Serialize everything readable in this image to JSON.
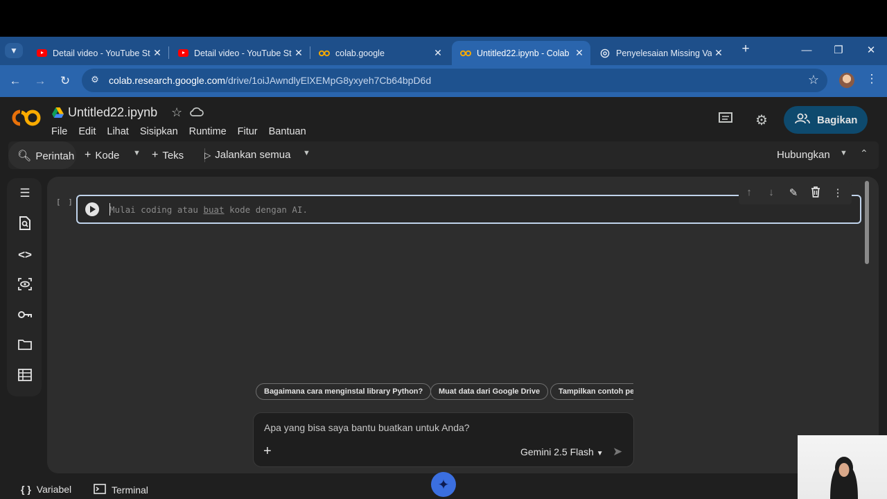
{
  "browser": {
    "tabs": [
      {
        "title": "Detail video - YouTube Studio",
        "icon": "youtube-icon",
        "active": false
      },
      {
        "title": "Detail video - YouTube Studio",
        "icon": "youtube-icon",
        "active": false
      },
      {
        "title": "colab.google",
        "icon": "colab-icon",
        "active": false
      },
      {
        "title": "Untitled22.ipynb - Colab",
        "icon": "colab-icon",
        "active": true
      },
      {
        "title": "Penyelesaian Missing Values",
        "icon": "chatgpt-icon",
        "active": false
      }
    ],
    "url_host": "colab.research.google.com",
    "url_path": "/drive/1oiJAwndlyElXEMpG8yxyeh7Cb64bpD6d"
  },
  "colab": {
    "notebook_title": "Untitled22.ipynb",
    "menu": [
      "File",
      "Edit",
      "Lihat",
      "Sisipkan",
      "Runtime",
      "Fitur",
      "Bantuan"
    ],
    "share_label": "Bagikan",
    "toolbar": {
      "commands": "Perintah",
      "code": "Kode",
      "text": "Teks",
      "run_all": "Jalankan semua",
      "connect": "Hubungkan"
    },
    "cell": {
      "bracket": "[ ]",
      "placeholder_a": "Mulai coding atau ",
      "placeholder_link": "buat",
      "placeholder_b": " kode dengan AI."
    },
    "suggestions": [
      "Bagaimana cara menginstal library Python?",
      "Muat data dari Google Drive",
      "Tampilkan contoh pe"
    ],
    "prompt_placeholder": "Apa yang bisa saya bantu buatkan untuk Anda?",
    "model": "Gemini 2.5 Flash",
    "bottom": {
      "variables": "Variabel",
      "terminal": "Terminal"
    }
  },
  "colors": {
    "tab_strip": "#1e4f8a",
    "active_tab": "#2a65ad",
    "share_button": "#0e4a6e",
    "gemini_button": "#3b6fe0"
  }
}
